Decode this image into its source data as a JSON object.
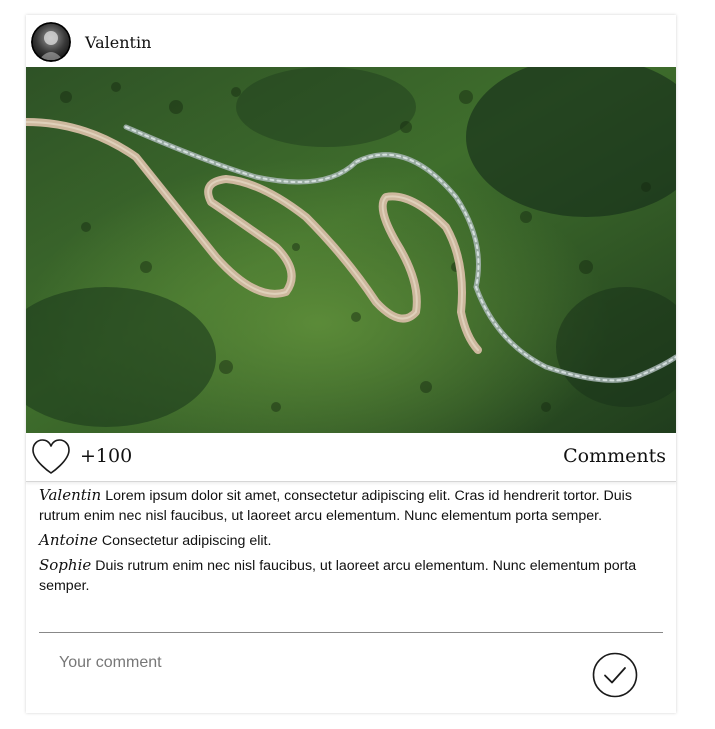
{
  "post": {
    "username": "Valentin",
    "likes": "+100",
    "comments_label": "Comments",
    "photo_alt": "Aerial view of a winding mountain road through a pine forest"
  },
  "icons": {
    "like": "heart-outline-icon",
    "submit": "check-circle-icon"
  },
  "comments": [
    {
      "author": "Valentin",
      "text": "Lorem ipsum dolor sit amet, consectetur adipiscing elit. Cras id hendrerit tortor. Duis rutrum enim nec nisl faucibus, ut laoreet arcu elementum. Nunc elementum porta semper."
    },
    {
      "author": "Antoine",
      "text": "Consectetur adipiscing elit."
    },
    {
      "author": "Sophie",
      "text": "Duis rutrum enim nec nisl faucibus, ut laoreet arcu elementum. Nunc elementum porta semper."
    }
  ],
  "composer": {
    "placeholder": "Your comment",
    "value": ""
  },
  "colors": {
    "forest_dark": "#1c3a1a",
    "forest_light": "#4f7f32",
    "road": "#cdb89e",
    "river": "#b8c4c4"
  }
}
